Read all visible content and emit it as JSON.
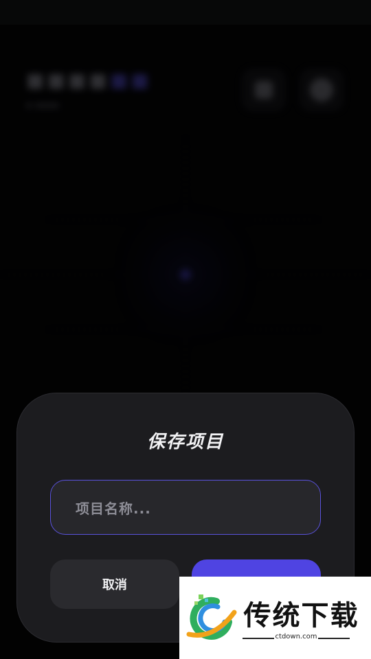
{
  "dialog": {
    "title": "保存项目",
    "name_placeholder": "项目名称...",
    "cancel_label": "取消",
    "confirm_label": ""
  },
  "watermark": {
    "title": "传统下载",
    "url": "ctdown.com"
  },
  "colors": {
    "accent": "#4f44e2",
    "dialog_bg": "#1c1c1f",
    "field_border": "#5a52dc"
  }
}
